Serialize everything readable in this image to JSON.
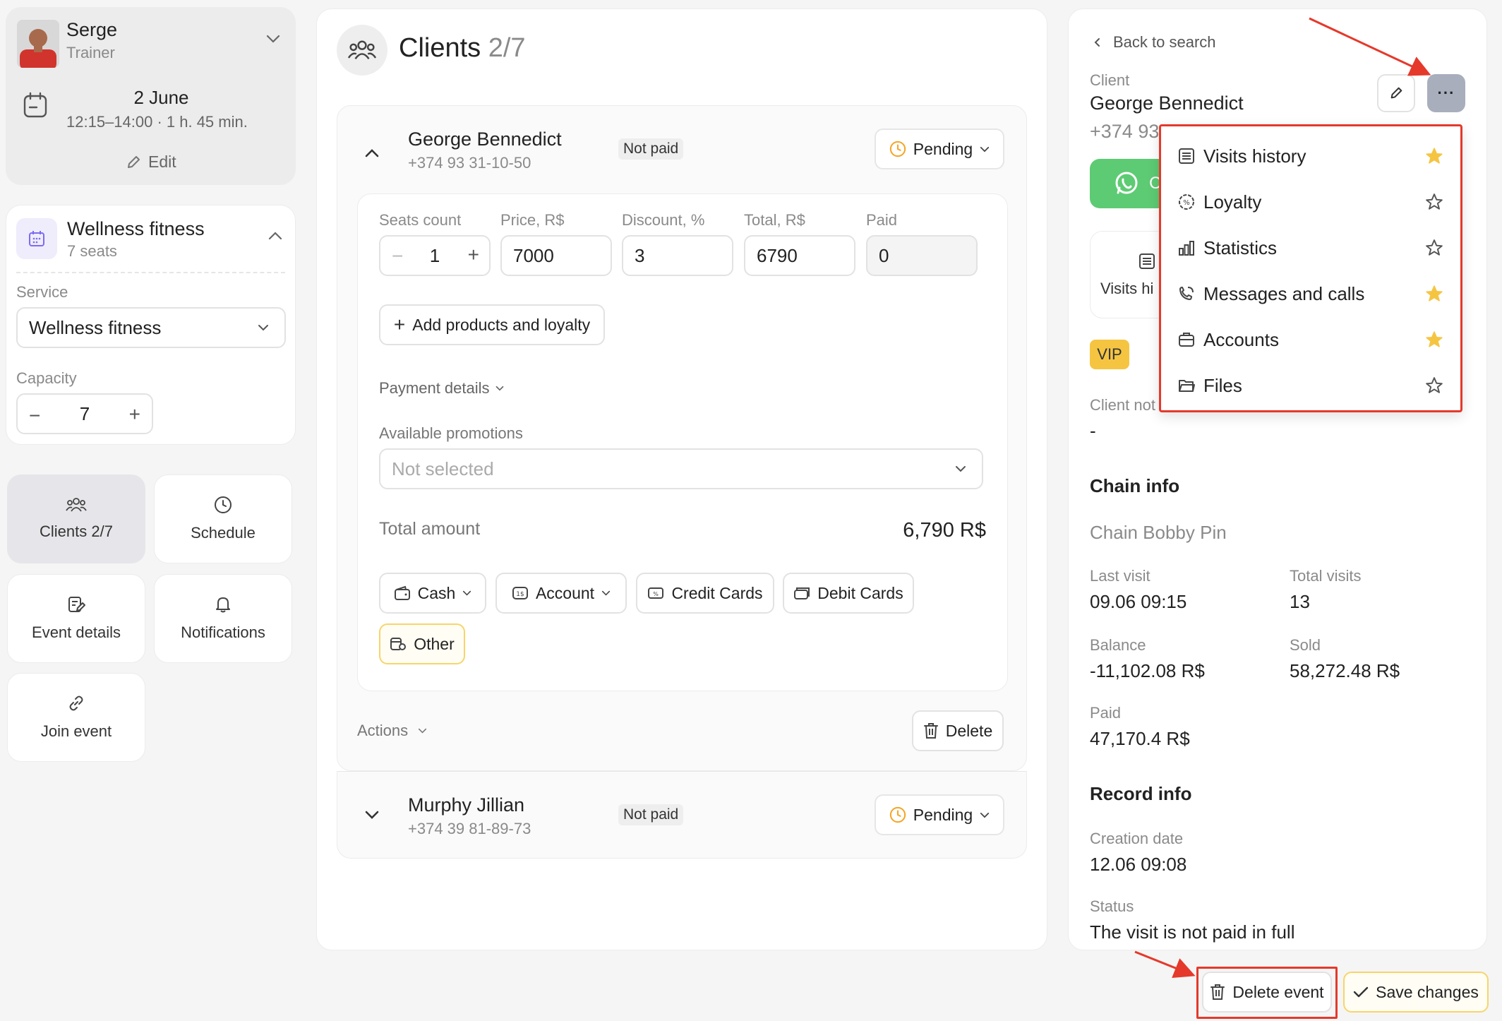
{
  "trainer": {
    "name": "Serge",
    "role": "Trainer"
  },
  "event": {
    "date": "2 June",
    "time": "12:15–14:00 · 1 h. 45 min.",
    "edit_label": "Edit"
  },
  "service_card": {
    "title": "Wellness fitness",
    "seats": "7 seats",
    "service_label": "Service",
    "service_value": "Wellness fitness",
    "capacity_label": "Capacity",
    "capacity_value": "7"
  },
  "tiles": {
    "clients": "Clients 2/7",
    "schedule": "Schedule",
    "event_details": "Event details",
    "notifications": "Notifications",
    "join_event": "Join event"
  },
  "clients_panel": {
    "title": "Clients",
    "count": "2/7",
    "clients": [
      {
        "name": "George Bennedict",
        "phone": "+374 93 31-10-50",
        "paid_badge": "Not paid",
        "status": "Pending"
      },
      {
        "name": "Murphy Jillian",
        "phone": "+374 39 81-89-73",
        "paid_badge": "Not paid",
        "status": "Pending"
      }
    ],
    "fields": {
      "seats_label": "Seats count",
      "seats_value": "1",
      "price_label": "Price, R$",
      "price_value": "7000",
      "discount_label": "Discount, %",
      "discount_value": "3",
      "total_label": "Total, R$",
      "total_value": "6790",
      "paid_label": "Paid",
      "paid_value": "0"
    },
    "add_products": "Add products and loyalty",
    "payment_details": "Payment details",
    "promotions_label": "Available promotions",
    "promotions_placeholder": "Not selected",
    "total_amount_label": "Total amount",
    "total_amount_value": "6,790 R$",
    "payment_methods": {
      "cash": "Cash",
      "account": "Account",
      "credit": "Credit Cards",
      "debit": "Debit Cards",
      "other": "Other"
    },
    "actions_label": "Actions",
    "delete_label": "Delete"
  },
  "right_panel": {
    "back": "Back to search",
    "client_label": "Client",
    "client_name": "George Bennedict",
    "client_phone": "+374 93",
    "whatsapp_text": "C",
    "visits_tile": "Visits hi",
    "vip": "VIP",
    "client_notes_label": "Client not",
    "client_notes_value": "-",
    "chain_info_title": "Chain info",
    "chain_name": "Chain Bobby Pin",
    "last_visit_label": "Last visit",
    "last_visit_value": "09.06 09:15",
    "total_visits_label": "Total visits",
    "total_visits_value": "13",
    "balance_label": "Balance",
    "balance_value": "-11,102.08 R$",
    "sold_label": "Sold",
    "sold_value": "58,272.48 R$",
    "paid_label": "Paid",
    "paid_value": "47,170.4 R$",
    "record_info_title": "Record info",
    "creation_label": "Creation date",
    "creation_value": "12.06 09:08",
    "status_label": "Status",
    "status_value": "The visit is not paid in full"
  },
  "dropdown_menu": {
    "items": [
      {
        "label": "Visits history",
        "starred": true
      },
      {
        "label": "Loyalty",
        "starred": false
      },
      {
        "label": "Statistics",
        "starred": false
      },
      {
        "label": "Messages and calls",
        "starred": true
      },
      {
        "label": "Accounts",
        "starred": true
      },
      {
        "label": "Files",
        "starred": false
      }
    ]
  },
  "footer": {
    "delete_event": "Delete event",
    "save_changes": "Save changes"
  },
  "colors": {
    "accent_yellow": "#f5c542",
    "annotation_red": "#e5392b",
    "whatsapp_green": "#5dcb73",
    "purple_icon": "#7b6cf0"
  }
}
